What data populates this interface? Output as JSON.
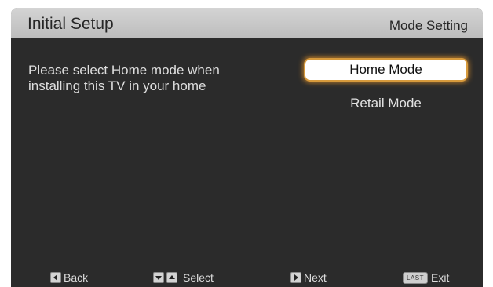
{
  "header": {
    "title": "Initial Setup",
    "subtitle": "Mode Setting"
  },
  "prompt": "Please select Home mode when\ninstalling this TV in your home",
  "options": [
    {
      "label": "Home Mode",
      "selected": true
    },
    {
      "label": "Retail Mode",
      "selected": false
    }
  ],
  "footer": {
    "back": "Back",
    "select": "Select",
    "next": "Next",
    "last_key": "LAST",
    "exit": "Exit"
  },
  "colors": {
    "background": "#2b2b2b",
    "header": "#c8c8c8",
    "highlight_glow": "#d79a3c"
  }
}
